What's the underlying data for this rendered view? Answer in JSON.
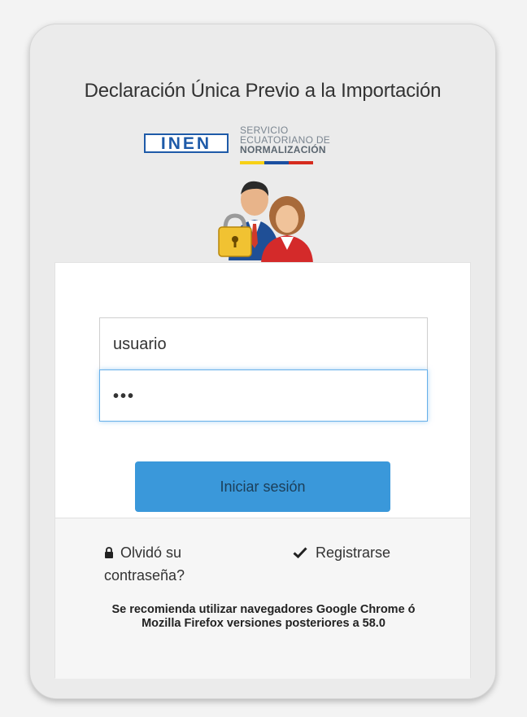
{
  "header": {
    "title": "Declaración Única Previo a la Importación"
  },
  "logo": {
    "acronym": "INEN",
    "line1": "SERVICIO",
    "line2": "ECUATORIANO DE",
    "line3": "NORMALIZACIÓN",
    "flag_colors": [
      "#f7d117",
      "#1b4fa0",
      "#d52b1e"
    ]
  },
  "icons": {
    "users": "users-lock-icon",
    "lock": "lock-icon",
    "check": "check-icon"
  },
  "form": {
    "username_value": "usuario",
    "password_value": "•••",
    "login_label": "Iniciar sesión"
  },
  "footer": {
    "forgot_label": "Olvidó su contraseña?",
    "register_label": "Registrarse",
    "note": "Se recomienda utilizar navegadores Google Chrome ó Mozilla Firefox versiones posteriores a 58.0"
  },
  "colors": {
    "primary_button": "#3a98da",
    "focus_border": "#66afe9"
  }
}
